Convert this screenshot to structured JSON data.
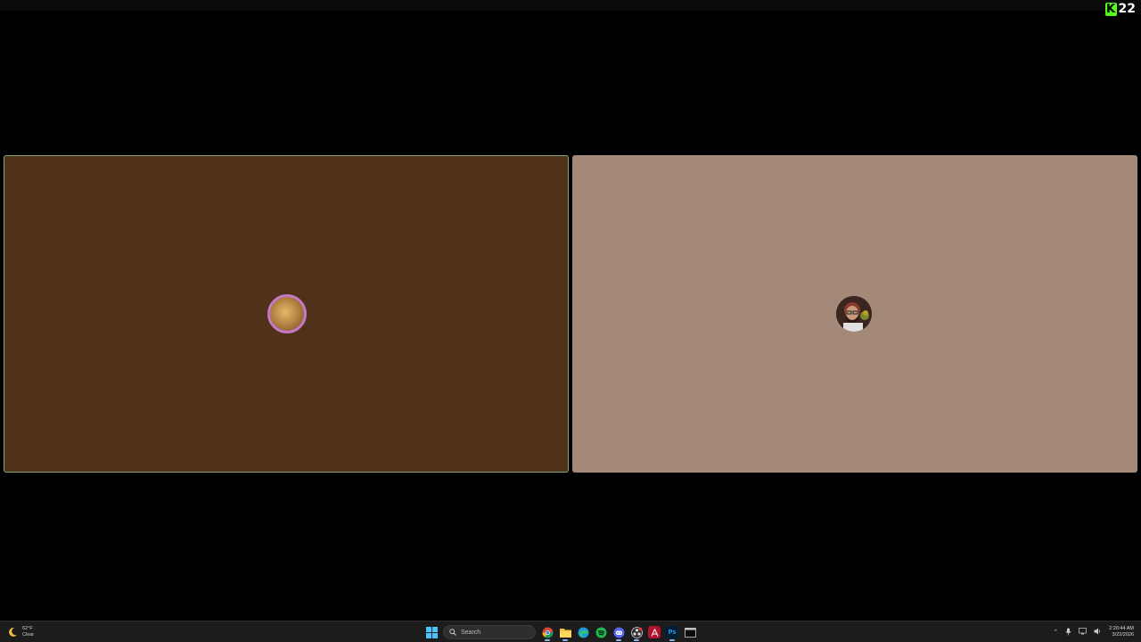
{
  "overlay": {
    "viewer_count": "22"
  },
  "tiles": [
    {
      "name": "left",
      "background": "#50321b"
    },
    {
      "name": "right",
      "background": "#a48878"
    }
  ],
  "taskbar": {
    "weather": {
      "temp": "62°F",
      "condition": "Clear"
    },
    "search": {
      "placeholder": "Search"
    },
    "apps": [
      "start-icon",
      "chrome-icon",
      "file-explorer-icon",
      "edge-icon",
      "spotify-icon",
      "discord-icon",
      "obs-icon",
      "acrobat-icon",
      "photoshop-icon",
      "terminal-icon"
    ],
    "photoshop_label": "Ps",
    "clock": {
      "time": "2:20:44 AM",
      "date": "3/22/2026"
    }
  },
  "colors": {
    "kick_green": "#53fc18"
  }
}
